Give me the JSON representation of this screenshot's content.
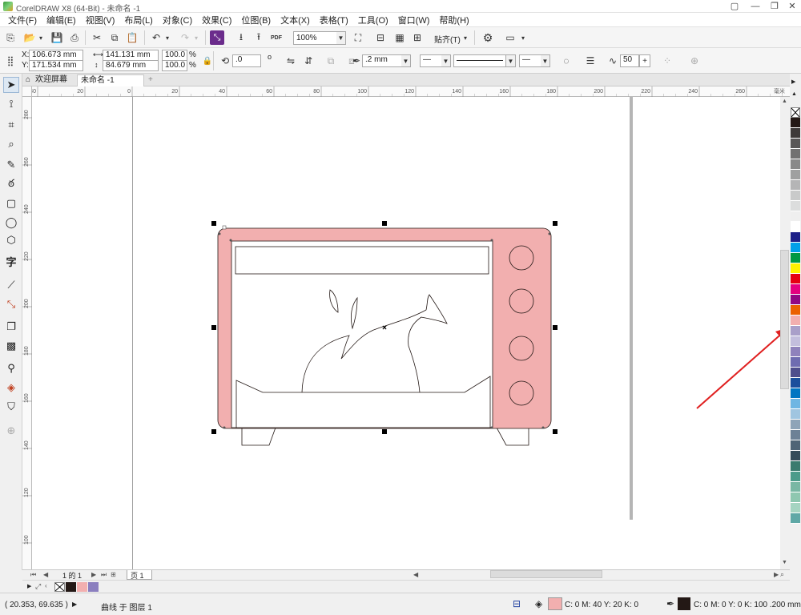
{
  "window": {
    "title": "CorelDRAW X8 (64-Bit) - 未命名 -1",
    "minimize_glyph": "—",
    "restore_glyph": "❐",
    "close_glyph": "✕"
  },
  "menu": [
    "文件(F)",
    "编辑(E)",
    "视图(V)",
    "布局(L)",
    "对象(C)",
    "效果(C)",
    "位图(B)",
    "文本(X)",
    "表格(T)",
    "工具(O)",
    "窗口(W)",
    "帮助(H)"
  ],
  "standard_toolbar": {
    "zoom_value": "100%",
    "snap_label": "贴齐(T)",
    "pdf_label": "PDF"
  },
  "property_bar": {
    "x_label": "X:",
    "x_value": "106.673 mm",
    "y_label": "Y:",
    "y_value": "171.534 mm",
    "width_value": "141.131 mm",
    "height_value": "84.679 mm",
    "scale_x": "100.0",
    "scale_y": "100.0",
    "percent": "%",
    "rotation_value": ".0",
    "degree": "o",
    "outline_width": ".2 mm",
    "smoothing_value": "50"
  },
  "tabs": {
    "welcome": "欢迎屏幕",
    "document": "未命名 -1",
    "add": "+"
  },
  "ruler": {
    "h_ticks": [
      "40",
      "20",
      "0",
      "20",
      "40",
      "60",
      "80",
      "100",
      "120",
      "140",
      "160",
      "180",
      "200",
      "220",
      "240",
      "260"
    ],
    "v_ticks": [
      "280",
      "260",
      "240",
      "220",
      "200",
      "180",
      "160",
      "140",
      "120",
      "100"
    ],
    "unit": "毫米"
  },
  "page_nav": {
    "position": "1 的 1",
    "page_tab": "页 1"
  },
  "status": {
    "cursor": "( 20.353, 69.635 )",
    "object_info": "曲线 于 图层 1",
    "fill_info": "C: 0 M: 40 Y: 20 K: 0",
    "outline_info": "C: 0 M: 0 Y: 0 K: 100  .200 mm"
  },
  "colors": {
    "oven_fill": "#f2afaf",
    "outline_black": "#231815",
    "annotation_red": "#e02020",
    "highlight_swatch": "#f2afaf"
  },
  "palette_colors": [
    "#231815",
    "#3e3a39",
    "#595757",
    "#727171",
    "#898989",
    "#9fa0a0",
    "#b5b5b6",
    "#c9caca",
    "#dcdddd",
    "#efefef",
    "#ffffff",
    "#1d2088",
    "#00a0e9",
    "#009944",
    "#fff100",
    "#e60012",
    "#e4007f",
    "#920783",
    "#eb6100",
    "#f2afaf",
    "#a99fc9",
    "#c3bedd",
    "#8f82bc",
    "#6f6cb0",
    "#4f4e8c",
    "#1b4f9c",
    "#0075c2",
    "#6fb6e3",
    "#a0c5e0",
    "#8ea4b8",
    "#6d8196",
    "#4f6476",
    "#354c5a",
    "#3b7b6f",
    "#4c9b8a",
    "#79b7a4",
    "#8ec7b0",
    "#a5d4c1",
    "#5fa8a6"
  ],
  "doc_palette": [
    "none",
    "#231815",
    "#f2afaf",
    "#8b7fbf"
  ]
}
